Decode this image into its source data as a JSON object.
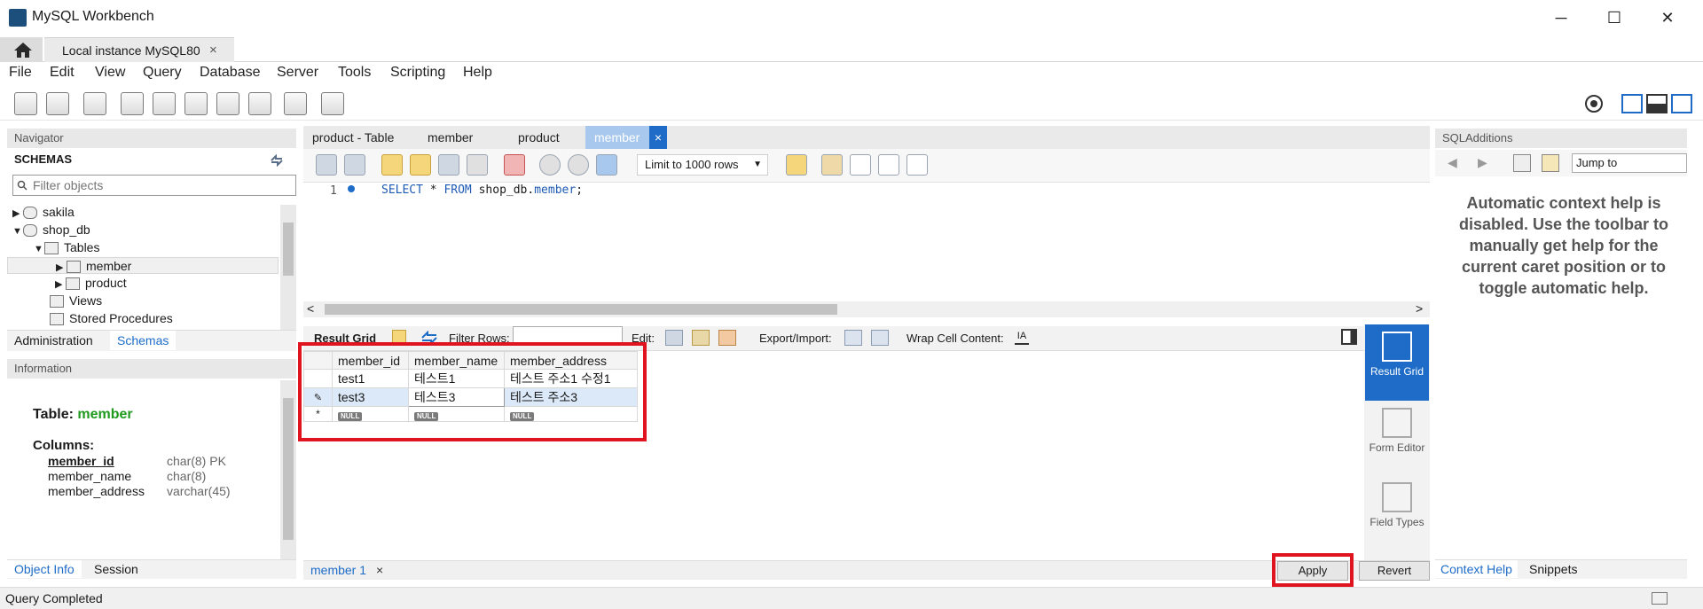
{
  "window": {
    "title": "MySQL Workbench",
    "controls": {
      "minimize": "─",
      "maximize": "☐",
      "close": "✕"
    }
  },
  "tabs": {
    "home_icon": "home-icon",
    "connection_tab": "Local instance MySQL80",
    "close_glyph": "×"
  },
  "menu": [
    "File",
    "Edit",
    "View",
    "Query",
    "Database",
    "Server",
    "Tools",
    "Scripting",
    "Help"
  ],
  "navigator": {
    "title": "Navigator",
    "schemas_label": "SCHEMAS",
    "filter_placeholder": "Filter objects",
    "tree": {
      "sakila": "sakila",
      "shop_db": "shop_db",
      "tables": "Tables",
      "member": "member",
      "product": "product",
      "views": "Views",
      "stored_procedures": "Stored Procedures"
    },
    "bottom_tabs": {
      "administration": "Administration",
      "schemas": "Schemas"
    }
  },
  "information": {
    "title": "Information",
    "table_label": "Table:",
    "table_name": "member",
    "columns_label": "Columns:",
    "columns": [
      {
        "name": "member_id",
        "type": "char(8) PK"
      },
      {
        "name": "member_name",
        "type": "char(8)"
      },
      {
        "name": "member_address",
        "type": "varchar(45)"
      }
    ],
    "bottom_tabs": {
      "object_info": "Object Info",
      "session": "Session"
    }
  },
  "editor": {
    "tabs": [
      "product - Table",
      "member",
      "product",
      "member"
    ],
    "active_tab_close": "×",
    "limit_select": "Limit to 1000 rows",
    "line_number": "1",
    "sql": {
      "select": "SELECT",
      "star": " * ",
      "from": "FROM",
      "target_pre": " shop_db.",
      "target_table": "member",
      "semicolon": ";"
    }
  },
  "result": {
    "result_grid_label": "Result Grid",
    "filter_rows_label": "Filter Rows:",
    "edit_label": "Edit:",
    "export_import_label": "Export/Import:",
    "wrap_label": "Wrap Cell Content:",
    "columns": [
      "member_id",
      "member_name",
      "member_address"
    ],
    "rows": [
      {
        "marker": "",
        "member_id": "test1",
        "member_name": "테스트1",
        "member_address": "테스트 주소1 수정1"
      },
      {
        "marker": "✎",
        "member_id": "test3",
        "member_name": "테스트3",
        "member_address": "테스트 주소3"
      },
      {
        "marker": "*",
        "member_id": "NULL",
        "member_name": "NULL",
        "member_address": "NULL"
      }
    ],
    "side_buttons": {
      "result_grid": "Result Grid",
      "form_editor": "Form Editor",
      "field_types": "Field Types"
    },
    "bottom_tab": "member 1",
    "apply": "Apply",
    "revert": "Revert"
  },
  "sql_additions": {
    "title": "SQLAdditions",
    "jump_to": "Jump to",
    "help_text": "Automatic context help is disabled. Use the toolbar to manually get help for the current caret position or to toggle automatic help.",
    "bottom_tabs": {
      "context_help": "Context Help",
      "snippets": "Snippets"
    }
  },
  "status_bar": {
    "text": "Query Completed"
  },
  "colors": {
    "highlight_red": "#e0141e",
    "accent_blue": "#1e6cc8",
    "table_name_green": "#1f9a1f"
  }
}
